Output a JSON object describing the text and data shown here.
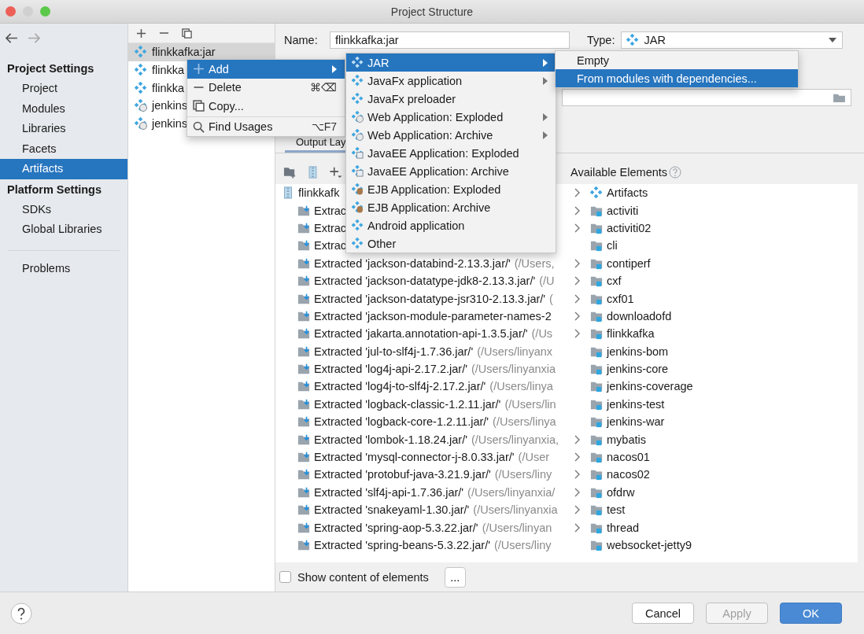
{
  "window": {
    "title": "Project Structure"
  },
  "nav": [
    {
      "kind": "back",
      "disabled": false
    },
    {
      "kind": "forward",
      "disabled": true
    }
  ],
  "sidebar": {
    "sections": [
      {
        "title": "Project Settings",
        "items": [
          {
            "label": "Project",
            "selected": false
          },
          {
            "label": "Modules",
            "selected": false
          },
          {
            "label": "Libraries",
            "selected": false
          },
          {
            "label": "Facets",
            "selected": false
          },
          {
            "label": "Artifacts",
            "selected": true
          }
        ]
      },
      {
        "title": "Platform Settings",
        "items": [
          {
            "label": "SDKs",
            "selected": false
          },
          {
            "label": "Global Libraries",
            "selected": false
          }
        ]
      }
    ],
    "footer_items": [
      {
        "label": "Problems",
        "selected": false
      }
    ]
  },
  "artifacts": [
    {
      "label": "flinkkafka:jar",
      "kind": "jar",
      "selected": true
    },
    {
      "label": "flinkka",
      "kind": "jar",
      "selected": false
    },
    {
      "label": "flinkka",
      "kind": "jar",
      "selected": false
    },
    {
      "label": "jenkins",
      "kind": "web",
      "selected": false
    },
    {
      "label": "jenkins",
      "kind": "web",
      "selected": false
    }
  ],
  "form": {
    "name_label": "Name:",
    "name_value": "flinkkafka:jar",
    "type_label": "Type:",
    "type_value": "JAR"
  },
  "tabs": [
    {
      "label": "Output Lay",
      "selected": true
    }
  ],
  "layout_tree": {
    "root": "flinkkafk",
    "rows": [
      {
        "name": "Extrac"
      },
      {
        "name": "Extrac"
      },
      {
        "name": "Extrac"
      },
      {
        "name": "Extracted 'jackson-databind-2.13.3.jar/'",
        "path": "(/Users,"
      },
      {
        "name": "Extracted 'jackson-datatype-jdk8-2.13.3.jar/'",
        "path": "(/U"
      },
      {
        "name": "Extracted 'jackson-datatype-jsr310-2.13.3.jar/'",
        "path": "("
      },
      {
        "name": "Extracted 'jackson-module-parameter-names-2"
      },
      {
        "name": "Extracted 'jakarta.annotation-api-1.3.5.jar/'",
        "path": "(/Us"
      },
      {
        "name": "Extracted 'jul-to-slf4j-1.7.36.jar/'",
        "path": "(/Users/linyanx"
      },
      {
        "name": "Extracted 'log4j-api-2.17.2.jar/'",
        "path": "(/Users/linyanxia"
      },
      {
        "name": "Extracted 'log4j-to-slf4j-2.17.2.jar/'",
        "path": "(/Users/linya"
      },
      {
        "name": "Extracted 'logback-classic-1.2.11.jar/'",
        "path": "(/Users/lin"
      },
      {
        "name": "Extracted 'logback-core-1.2.11.jar/'",
        "path": "(/Users/linya"
      },
      {
        "name": "Extracted 'lombok-1.18.24.jar/'",
        "path": "(/Users/linyanxia,"
      },
      {
        "name": "Extracted 'mysql-connector-j-8.0.33.jar/'",
        "path": "(/User"
      },
      {
        "name": "Extracted 'protobuf-java-3.21.9.jar/'",
        "path": "(/Users/liny"
      },
      {
        "name": "Extracted 'slf4j-api-1.7.36.jar/'",
        "path": "(/Users/linyanxia/"
      },
      {
        "name": "Extracted 'snakeyaml-1.30.jar/'",
        "path": "(/Users/linyanxia"
      },
      {
        "name": "Extracted 'spring-aop-5.3.22.jar/'",
        "path": "(/Users/linyan"
      },
      {
        "name": "Extracted 'spring-beans-5.3.22.jar/'",
        "path": "(/Users/liny"
      }
    ]
  },
  "available": {
    "title": "Available Elements",
    "items": [
      {
        "label": "Artifacts",
        "kind": "artifacts",
        "expandable": true
      },
      {
        "label": "activiti",
        "kind": "module",
        "expandable": true
      },
      {
        "label": "activiti02",
        "kind": "module",
        "expandable": true
      },
      {
        "label": "cli",
        "kind": "module",
        "expandable": false
      },
      {
        "label": "contiperf",
        "kind": "module",
        "expandable": true
      },
      {
        "label": "cxf",
        "kind": "module",
        "expandable": true
      },
      {
        "label": "cxf01",
        "kind": "module",
        "expandable": true
      },
      {
        "label": "downloadofd",
        "kind": "module",
        "expandable": true
      },
      {
        "label": "flinkkafka",
        "kind": "module",
        "expandable": true
      },
      {
        "label": "jenkins-bom",
        "kind": "module",
        "expandable": false
      },
      {
        "label": "jenkins-core",
        "kind": "module",
        "expandable": false
      },
      {
        "label": "jenkins-coverage",
        "kind": "module",
        "expandable": false
      },
      {
        "label": "jenkins-test",
        "kind": "module",
        "expandable": false
      },
      {
        "label": "jenkins-war",
        "kind": "module",
        "expandable": false
      },
      {
        "label": "mybatis",
        "kind": "module",
        "expandable": true
      },
      {
        "label": "nacos01",
        "kind": "module",
        "expandable": true
      },
      {
        "label": "nacos02",
        "kind": "module",
        "expandable": true
      },
      {
        "label": "ofdrw",
        "kind": "module",
        "expandable": true
      },
      {
        "label": "test",
        "kind": "module",
        "expandable": true
      },
      {
        "label": "thread",
        "kind": "module",
        "expandable": true
      },
      {
        "label": "websocket-jetty9",
        "kind": "module",
        "expandable": false
      }
    ]
  },
  "show_content": {
    "label": "Show content of elements",
    "checked": false
  },
  "more_button": "...",
  "buttons": [
    {
      "label": "Cancel",
      "kind": "normal",
      "disabled": false
    },
    {
      "label": "Apply",
      "kind": "normal",
      "disabled": true
    },
    {
      "label": "OK",
      "kind": "default",
      "disabled": false
    }
  ],
  "context_menu": [
    {
      "label": "Add",
      "kind": "add",
      "submenu": true,
      "selected": true,
      "separator_before": false
    },
    {
      "label": "Delete",
      "kind": "delete",
      "shortcut": "⌘⌫",
      "submenu": false,
      "selected": false,
      "separator_before": false
    },
    {
      "label": "Copy...",
      "kind": "copy",
      "submenu": false,
      "selected": false,
      "separator_before": false
    },
    {
      "label": "Find Usages",
      "kind": "find",
      "shortcut": "⌥F7",
      "submenu": false,
      "selected": false,
      "separator_before": true
    }
  ],
  "add_menu": [
    {
      "label": "JAR",
      "kind": "jar",
      "submenu": true,
      "selected": true
    },
    {
      "label": "JavaFx application",
      "kind": "jar",
      "submenu": true,
      "selected": false
    },
    {
      "label": "JavaFx preloader",
      "kind": "jar",
      "submenu": false,
      "selected": false
    },
    {
      "label": "Web Application: Exploded",
      "kind": "web",
      "submenu": true,
      "selected": false
    },
    {
      "label": "Web Application: Archive",
      "kind": "web",
      "submenu": true,
      "selected": false
    },
    {
      "label": "JavaEE Application: Exploded",
      "kind": "javaee",
      "submenu": false,
      "selected": false
    },
    {
      "label": "JavaEE Application: Archive",
      "kind": "javaee",
      "submenu": false,
      "selected": false
    },
    {
      "label": "EJB Application: Exploded",
      "kind": "ejb",
      "submenu": false,
      "selected": false
    },
    {
      "label": "EJB Application: Archive",
      "kind": "ejb",
      "submenu": false,
      "selected": false
    },
    {
      "label": "Android application",
      "kind": "jar",
      "submenu": false,
      "selected": false
    },
    {
      "label": "Other",
      "kind": "jar",
      "submenu": false,
      "selected": false
    }
  ],
  "jar_menu": [
    {
      "label": "Empty",
      "selected": false
    },
    {
      "label": "From modules with dependencies...",
      "selected": true
    }
  ]
}
